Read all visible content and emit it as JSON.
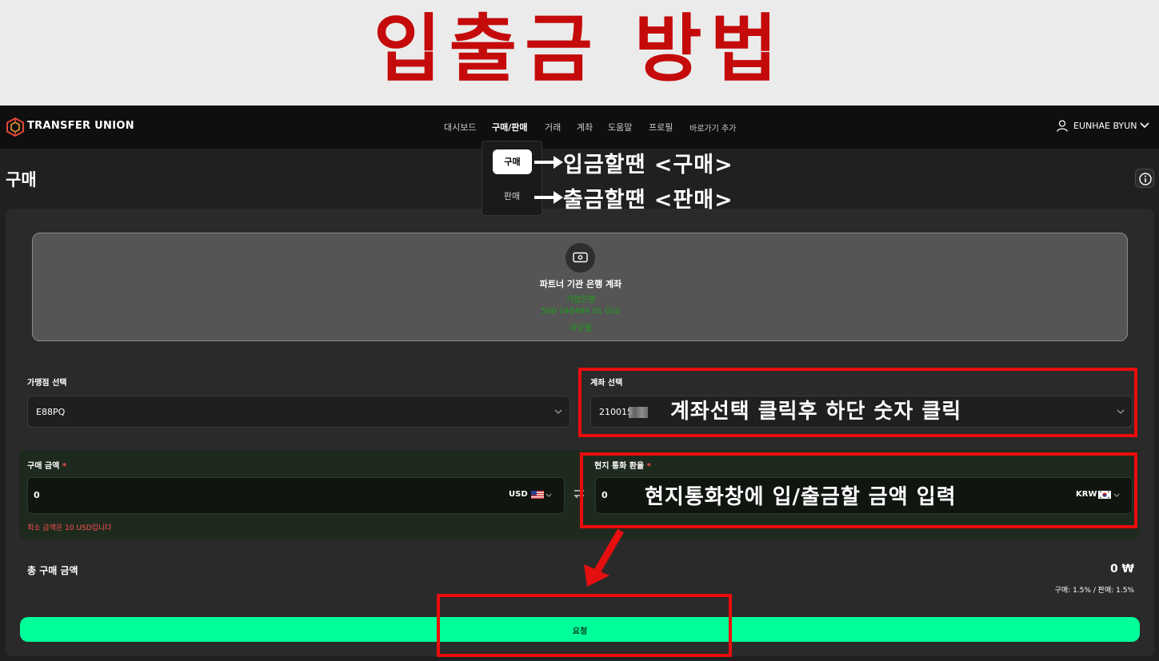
{
  "banner": {
    "title": "입출금 방법"
  },
  "navbar": {
    "brand": "TRANSFER UNION",
    "items": [
      {
        "label": "대시보드"
      },
      {
        "label": "구매/판매"
      },
      {
        "label": "거래"
      },
      {
        "label": "계좌"
      },
      {
        "label": "도움말"
      },
      {
        "label": "프로필"
      },
      {
        "label": "바로가기 추가"
      }
    ],
    "user_name": "EUNHAE BYUN"
  },
  "dropdown": {
    "buy": "구매",
    "sell": "판매"
  },
  "page": {
    "title": "구매"
  },
  "annotations": {
    "deposit": "입금할땐 <구매>",
    "withdraw": "출금할땐 <판매>",
    "account_hint": "계좌선택 클릭후 하단 숫자 클릭",
    "amount_hint": "현지통화창에 입/출금할 금액 입력"
  },
  "bank": {
    "label": "파트너 기관 은행 계좌",
    "bank_name": "기업은행",
    "account_number": "500 048484 01 010",
    "holder": "아모웹"
  },
  "form": {
    "merchant_label": "가맹점 선택",
    "merchant_value": "E88PQ",
    "account_label": "계좌 선택",
    "account_value": "210015",
    "buy_amount_label": "구매 금액",
    "buy_amount_value": "0",
    "buy_currency": "USD",
    "local_label": "현지 통화 환율",
    "local_value": "0",
    "local_currency": "KRW",
    "required_mark": "*",
    "min_note": "최소 금액은 10 USD입니다",
    "total_label": "총 구매 금액",
    "total_value": "0 ₩",
    "fee_note": "구매: 1.5% / 판매: 1.5%",
    "submit_label": "요청"
  },
  "colors": {
    "banner_title": "#c40a0a",
    "annotation_box": "#ea0d0d",
    "submit_button": "#00ff99",
    "bank_text": "#1aa01a",
    "error_text": "#ff5050"
  },
  "icons": [
    "logo-icon",
    "user-icon",
    "chevron-down-icon",
    "info-icon",
    "cash-icon",
    "swap-icon",
    "us-flag-icon",
    "kr-flag-icon",
    "arrow-right-icon",
    "arrow-down-icon"
  ]
}
